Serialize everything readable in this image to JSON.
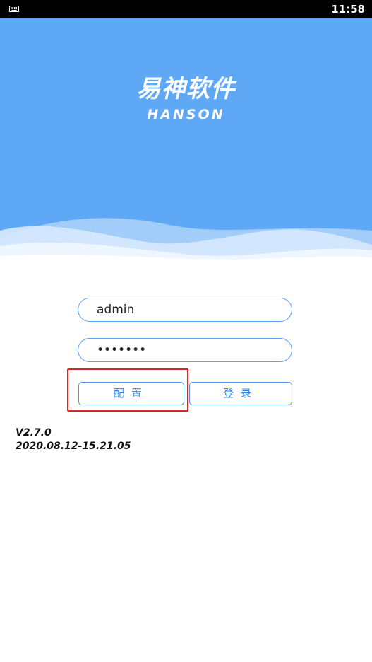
{
  "status_bar": {
    "time": "11:58",
    "icon": "keyboard-icon"
  },
  "header": {
    "logo_chinese": "易神软件",
    "logo_english": "HANSON",
    "background_color": "#5ea8f5"
  },
  "login_form": {
    "username_value": "admin",
    "password_value": "1234567"
  },
  "buttons": {
    "config_label": "配置",
    "login_label": "登录"
  },
  "version": {
    "number": "V2.7.0",
    "build_timestamp": "2020.08.12-15.21.05"
  },
  "colors": {
    "accent": "#3a86e6",
    "highlight": "#e0241c"
  }
}
